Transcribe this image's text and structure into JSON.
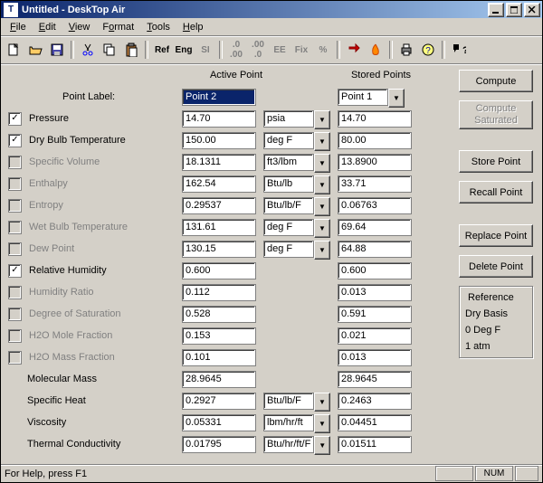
{
  "window": {
    "title": "Untitled - DeskTop Air"
  },
  "menu": {
    "file": "File",
    "edit": "Edit",
    "view": "View",
    "format": "Format",
    "tools": "Tools",
    "help": "Help"
  },
  "toolbar": {
    "ref": "Ref",
    "eng": "Eng",
    "si": "SI",
    "ee": "EE",
    "fix": "Fix",
    "pct": "%"
  },
  "headers": {
    "active": "Active Point",
    "stored": "Stored Points",
    "pointLabel": "Point Label:"
  },
  "active": {
    "label": "Point 2"
  },
  "stored": {
    "label": "Point 1"
  },
  "rows": {
    "pressure": {
      "label": "Pressure",
      "active": "14.70",
      "unit": "psia",
      "stored": "14.70"
    },
    "drybulb": {
      "label": "Dry Bulb Temperature",
      "active": "150.00",
      "unit": "deg F",
      "stored": "80.00"
    },
    "specvol": {
      "label": "Specific Volume",
      "active": "18.1311",
      "unit": "ft3/lbm",
      "stored": "13.8900"
    },
    "enthalpy": {
      "label": "Enthalpy",
      "active": "162.54",
      "unit": "Btu/lb",
      "stored": "33.71"
    },
    "entropy": {
      "label": "Entropy",
      "active": "0.29537",
      "unit": "Btu/lb/F",
      "stored": "0.06763"
    },
    "wetbulb": {
      "label": "Wet Bulb Temperature",
      "active": "131.61",
      "unit": "deg F",
      "stored": "69.64"
    },
    "dewpoint": {
      "label": "Dew Point",
      "active": "130.15",
      "unit": "deg F",
      "stored": "64.88"
    },
    "relhum": {
      "label": "Relative Humidity",
      "active": "0.600",
      "stored": "0.600"
    },
    "humratio": {
      "label": "Humidity Ratio",
      "active": "0.112",
      "stored": "0.013"
    },
    "degsat": {
      "label": "Degree of Saturation",
      "active": "0.528",
      "stored": "0.591"
    },
    "h2omole": {
      "label": "H2O Mole Fraction",
      "active": "0.153",
      "stored": "0.021"
    },
    "h2omass": {
      "label": "H2O Mass Fraction",
      "active": "0.101",
      "stored": "0.013"
    },
    "molmass": {
      "label": "Molecular Mass",
      "active": "28.9645",
      "stored": "28.9645"
    },
    "specheat": {
      "label": "Specific Heat",
      "active": "0.2927",
      "unit": "Btu/lb/F",
      "stored": "0.2463"
    },
    "viscosity": {
      "label": "Viscosity",
      "active": "0.05331",
      "unit": "lbm/hr/ft",
      "stored": "0.04451"
    },
    "thermcond": {
      "label": "Thermal Conductivity",
      "active": "0.01795",
      "unit": "Btu/hr/ft/F",
      "stored": "0.01511"
    }
  },
  "buttons": {
    "compute": "Compute",
    "computeSat": "Compute Saturated",
    "store": "Store Point",
    "recall": "Recall Point",
    "replace": "Replace Point",
    "delete": "Delete Point"
  },
  "reference": {
    "title": "Reference",
    "l1": "Dry Basis",
    "l2": "0 Deg F",
    "l3": "1 atm"
  },
  "status": {
    "help": "For Help, press F1",
    "num": "NUM"
  }
}
